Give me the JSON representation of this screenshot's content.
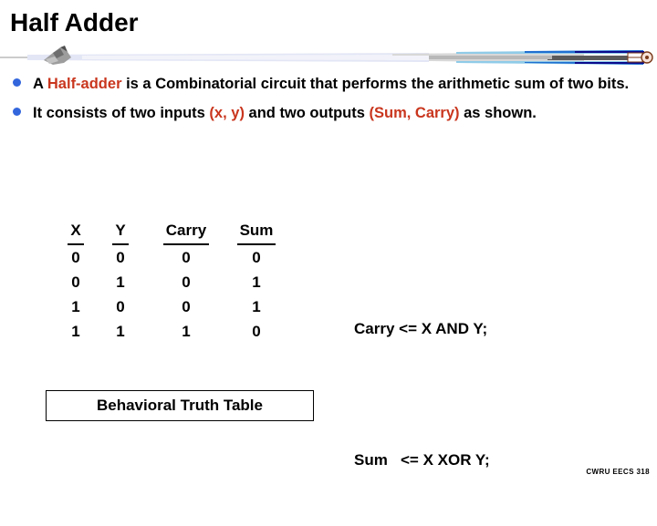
{
  "slide": {
    "title": "Half Adder",
    "footer": "CWRU EECS 318"
  },
  "colors": {
    "accent_red": "#c9361e",
    "bullet_blue": "#3366dd",
    "divider_navy": "#0a0a8c",
    "divider_blue": "#1f6fd0",
    "divider_lightblue": "#8fcbe8",
    "divider_pale": "#e3e6f5",
    "text_black": "#000000",
    "background": "#ffffff"
  },
  "bullets": [
    {
      "marker": "bullet-dot",
      "segments": [
        {
          "text": "A ",
          "style": "normal"
        },
        {
          "text": "Half-adder",
          "style": "red"
        },
        {
          "text": " is a Combinatorial circuit that performs  the arithmetic sum of two bits.",
          "style": "normal"
        }
      ]
    },
    {
      "marker": "bullet-dot",
      "segments": [
        {
          "text": "It consists of two inputs ",
          "style": "normal"
        },
        {
          "text": "(x, y)",
          "style": "red"
        },
        {
          "text": " and two outputs ",
          "style": "normal"
        },
        {
          "text": "(Sum, Carry)",
          "style": "red"
        },
        {
          "text": " as shown.",
          "style": "normal"
        }
      ]
    }
  ],
  "truth_table": {
    "headers": [
      "X",
      "Y",
      "Carry",
      "Sum"
    ],
    "rows": [
      [
        "0",
        "0",
        "0",
        "0"
      ],
      [
        "0",
        "1",
        "0",
        "1"
      ],
      [
        "1",
        "0",
        "0",
        "1"
      ],
      [
        "1",
        "1",
        "1",
        "0"
      ]
    ],
    "caption": "Behavioral Truth Table"
  },
  "equations": [
    "Carry <= X AND Y;",
    "Sum   <= X XOR Y;"
  ]
}
